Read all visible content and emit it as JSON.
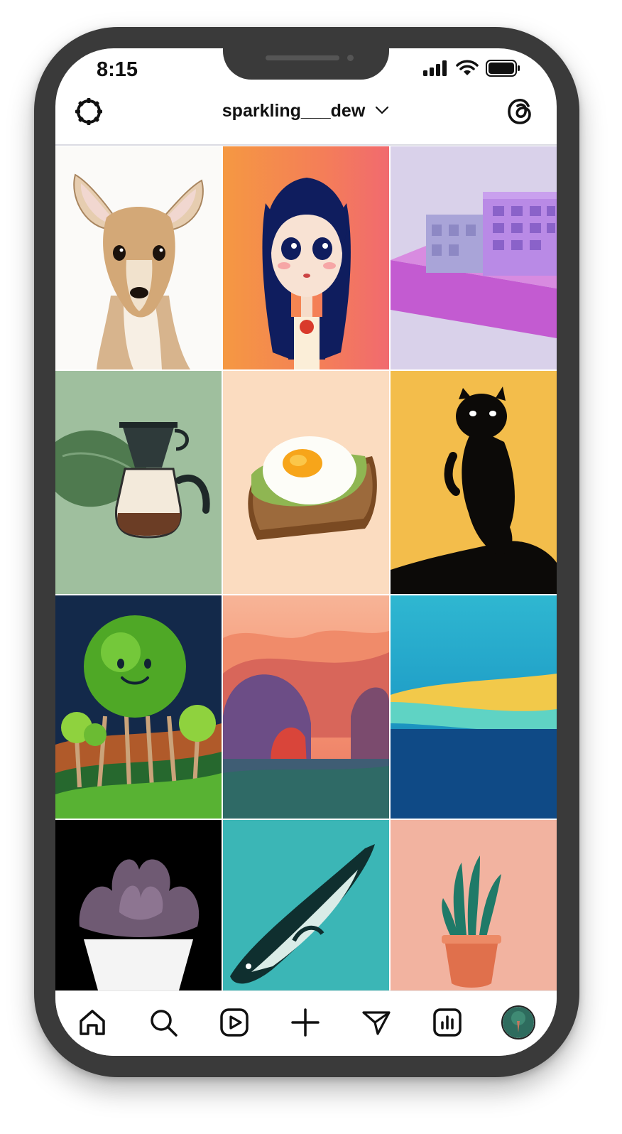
{
  "status_bar": {
    "time": "8:15",
    "icons": [
      "signal-icon",
      "wifi-icon",
      "battery-icon"
    ]
  },
  "header": {
    "username": "sparkling___dew",
    "left_icon": "settings-icon",
    "dropdown_icon": "chevron-down-icon",
    "right_icon": "threads-icon"
  },
  "grid": {
    "tiles": [
      {
        "subject": "deer",
        "bg": "#fbfaf8"
      },
      {
        "subject": "girl-with-dark-hair",
        "bg": "#f48c4a"
      },
      {
        "subject": "purple-houses",
        "bg": "#d9d1ea"
      },
      {
        "subject": "coffee-dripper",
        "bg": "#9fbf9e"
      },
      {
        "subject": "avocado-toast",
        "bg": "#fbdcc0"
      },
      {
        "subject": "black-cat",
        "bg": "#f3bd4b"
      },
      {
        "subject": "smiling-tree",
        "bg": "#13294a"
      },
      {
        "subject": "sunset-hills",
        "bg": "#f3a680"
      },
      {
        "subject": "ocean-beach",
        "bg": "#2fb7d1"
      },
      {
        "subject": "succulent",
        "bg": "#000000"
      },
      {
        "subject": "penguin",
        "bg": "#3bb6b6"
      },
      {
        "subject": "snake-plant",
        "bg": "#f2b3a0"
      }
    ]
  },
  "bottom_nav": {
    "items": [
      "home-icon",
      "search-icon",
      "reels-icon",
      "create-icon",
      "direct-icon",
      "insights-icon",
      "profile-avatar"
    ]
  }
}
